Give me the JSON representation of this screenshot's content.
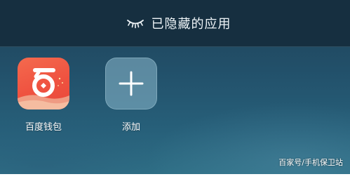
{
  "header": {
    "title": "已隐藏的应用",
    "icon": "eye-closed-icon"
  },
  "apps": [
    {
      "label": "百度钱包",
      "icon": "baidu-wallet-icon",
      "color": "#ef5240"
    },
    {
      "label": "添加",
      "icon": "plus-icon",
      "color": "#8cb9cd"
    }
  ],
  "watermark": "百家号/手机保卫站"
}
